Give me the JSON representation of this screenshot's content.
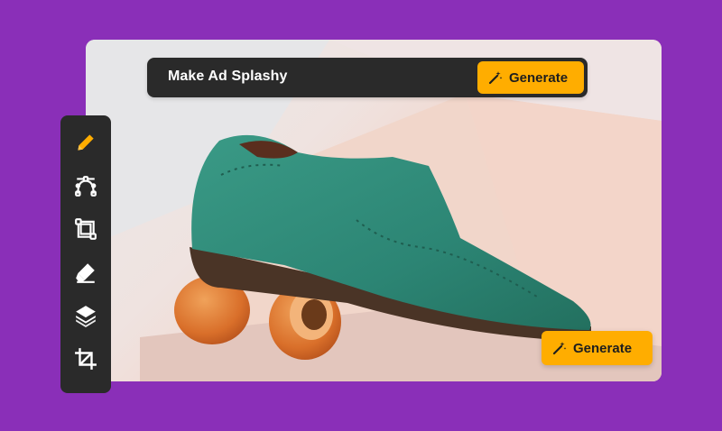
{
  "prompt": {
    "text": "Make Ad Splashy"
  },
  "buttons": {
    "generate_top": "Generate",
    "generate_bottom": "Generate"
  },
  "toolbar": {
    "tools": [
      "pencil-icon",
      "bezier-curve-icon",
      "transform-icon",
      "eraser-icon",
      "layers-icon",
      "crop-icon"
    ],
    "active": "pencil-icon"
  },
  "colors": {
    "background": "#8a2fb8",
    "panel": "#2a2a2a",
    "accent": "#ffad00",
    "shoe": "#2f8a78"
  }
}
